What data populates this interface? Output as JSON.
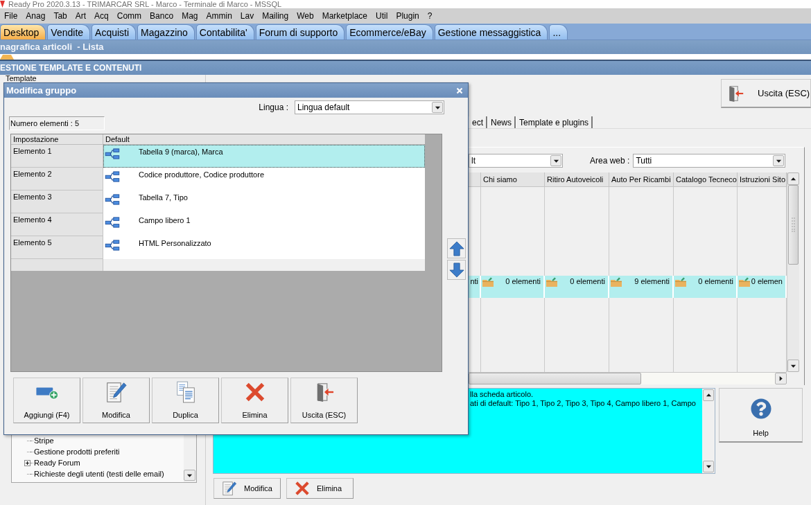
{
  "window": {
    "title": "Ready Pro 2020.3.13 - TRIMARCAR SRL - Marco - Terminale di Marco - MSSQL"
  },
  "menu_bar": [
    "File",
    "Anag",
    "Tab",
    "Art",
    "Acq",
    "Comm",
    "Banco",
    "Mag",
    "Ammin",
    "Lav",
    "Mailing",
    "Web",
    "Marketplace",
    "Util",
    "Plugin",
    "?"
  ],
  "module_tabs": [
    {
      "label": "Desktop",
      "selected": true
    },
    {
      "label": "Vendite",
      "selected": false
    },
    {
      "label": "Acquisti",
      "selected": false
    },
    {
      "label": "Magazzino",
      "selected": false
    },
    {
      "label": "Contabilita'",
      "selected": false
    },
    {
      "label": "Forum di supporto",
      "selected": false
    },
    {
      "label": "Ecommerce/eBay",
      "selected": false
    },
    {
      "label": "Gestione messaggistica",
      "selected": false
    },
    {
      "label": "...",
      "selected": false
    }
  ],
  "breadcrumb": "nagrafica articoli  - Lista",
  "section_title": "ESTIONE TEMPLATE E CONTENUTI",
  "template_group": {
    "label": "Template"
  },
  "exit_button": "Uscita (ESC)",
  "content_tabs": [
    {
      "label": "ect",
      "selected": false
    },
    {
      "label": "News",
      "selected": false
    },
    {
      "label": "Template e plugins",
      "selected": false
    }
  ],
  "filters": {
    "language_value": "lt",
    "area_label": "Area web :",
    "area_value": "Tutti"
  },
  "grid": {
    "columns": [
      "",
      "Chi siamo",
      "Ritiro Autoveicoli",
      "Auto Per Ricambi",
      "Catalogo Tecneco",
      "Istruzioni Sito"
    ],
    "rows": [
      {
        "selected": true,
        "cells": [
          {
            "kind": "partial",
            "text": "nti"
          },
          {
            "kind": "folder",
            "text": "0 elementi"
          },
          {
            "kind": "folder",
            "text": "0 elementi"
          },
          {
            "kind": "folder",
            "text": "9 elementi"
          },
          {
            "kind": "folder",
            "text": "0 elementi"
          },
          {
            "kind": "folder",
            "text": "0 elemen"
          }
        ]
      }
    ]
  },
  "description": {
    "lines": [
      "lla scheda articolo.",
      "ati di default: Tipo 1, Tipo 2, Tipo 3, Tipo 4, Campo libero 1, Campo"
    ]
  },
  "help_button": "Help",
  "bottom_buttons": [
    {
      "kind": "edit",
      "label": "Modifica"
    },
    {
      "kind": "delete",
      "label": "Elimina"
    }
  ],
  "tree": {
    "items": [
      {
        "kind": "leaf",
        "label": "Stripe"
      },
      {
        "kind": "leaf",
        "label": "Gestione prodotti preferiti"
      },
      {
        "kind": "group",
        "label": "Ready Forum"
      },
      {
        "kind": "leaf",
        "label": "Richieste degli utenti (testi delle email)"
      }
    ]
  },
  "dialog": {
    "title": "Modifica gruppo",
    "language_label": "Lingua :",
    "language_value": "Lingua default",
    "count_label": "Numero elementi : 5",
    "columns": [
      "Impostazione",
      "Default"
    ],
    "rows": [
      {
        "setting": "Elemento 1",
        "value": "Tabella 9 (marca), Marca",
        "selected": true
      },
      {
        "setting": "Elemento 2",
        "value": "Codice produttore, Codice produttore",
        "selected": false
      },
      {
        "setting": "Elemento 3",
        "value": "Tabella 7, Tipo",
        "selected": false
      },
      {
        "setting": "Elemento 4",
        "value": "Campo libero 1",
        "selected": false
      },
      {
        "setting": "Elemento 5",
        "value": "HTML Personalizzato",
        "selected": false
      }
    ],
    "buttons": [
      {
        "kind": "add",
        "label": "Aggiungi (F4)"
      },
      {
        "kind": "edit",
        "label": "Modifica"
      },
      {
        "kind": "duplicate",
        "label": "Duplica"
      },
      {
        "kind": "delete",
        "label": "Elimina"
      },
      {
        "kind": "exit",
        "label": "Uscita (ESC)"
      }
    ]
  }
}
